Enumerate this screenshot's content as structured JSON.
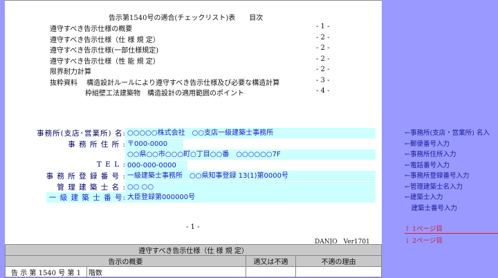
{
  "toc": {
    "title": "告示第1540号の適合(チェックリスト)表　　目次",
    "items": [
      {
        "label": "遵守すべき告示仕様の概要",
        "page": "- 1 -"
      },
      {
        "label": "遵守すべき告示仕様（仕 様 規 定）",
        "page": "- 2 -"
      },
      {
        "label": "遵守すべき告示仕様(一部仕様規定)",
        "page": "- 2 -"
      },
      {
        "label": "遵守すべき告示仕様（性 能 規 定）",
        "page": "- 2 -"
      },
      {
        "label": "限界耐力計算",
        "page": "- 2 -"
      },
      {
        "label": "抜粋資料　 構造設計ルールにより遵守すべき告示仕様及び必要な構造計算",
        "page": "- 3 -"
      },
      {
        "label": "枠組壁工法建築物　構造設計の適用範囲のポイント",
        "page": "- 4 -"
      }
    ]
  },
  "form": {
    "office_name_label": "事務所(支店･営業所) 名:",
    "office_name": "○○○○○株式会社　○○支店一級建築士事務所",
    "address_label": "事 務 所 住 所 :",
    "postal": "〒000-0000",
    "address": "○○県○○市○○○町○丁目○○番　○○○○○○7F",
    "tel_label": "T E L :",
    "tel": "000-000-0000",
    "reg_label": "事 務 所 登 録 番 号 :",
    "reg": "一級建築士事務所　○○県知事登録 13(1)第0000号",
    "manager_label": "管 理 建 築 士 名 :",
    "manager": "○○ ○○",
    "license_label": "一 級 建 築 士 番 号:",
    "license": "大臣登録第000000号"
  },
  "page_number": "- 1 -",
  "version": "DANJO　Ver1701",
  "table": {
    "title": "遵守すべき告示仕様（仕 様 規 定）",
    "headers": [
      "告示の概要",
      "適又は不適",
      "不適の理由"
    ],
    "row": [
      "告 示 第 1540 号 第 1",
      "階数"
    ]
  },
  "notes": [
    "←事務所(支店・営業所) 名入",
    "←郵便番号入力",
    "←事務所住所入力",
    "←電話番号入力",
    "←事務所登録番号入力",
    "←管理建築士名入力",
    "←建築士入力",
    "　建築士番号入力"
  ],
  "nav": {
    "up": "↑ 1ページ目",
    "down": "↓ 2ページ目"
  }
}
